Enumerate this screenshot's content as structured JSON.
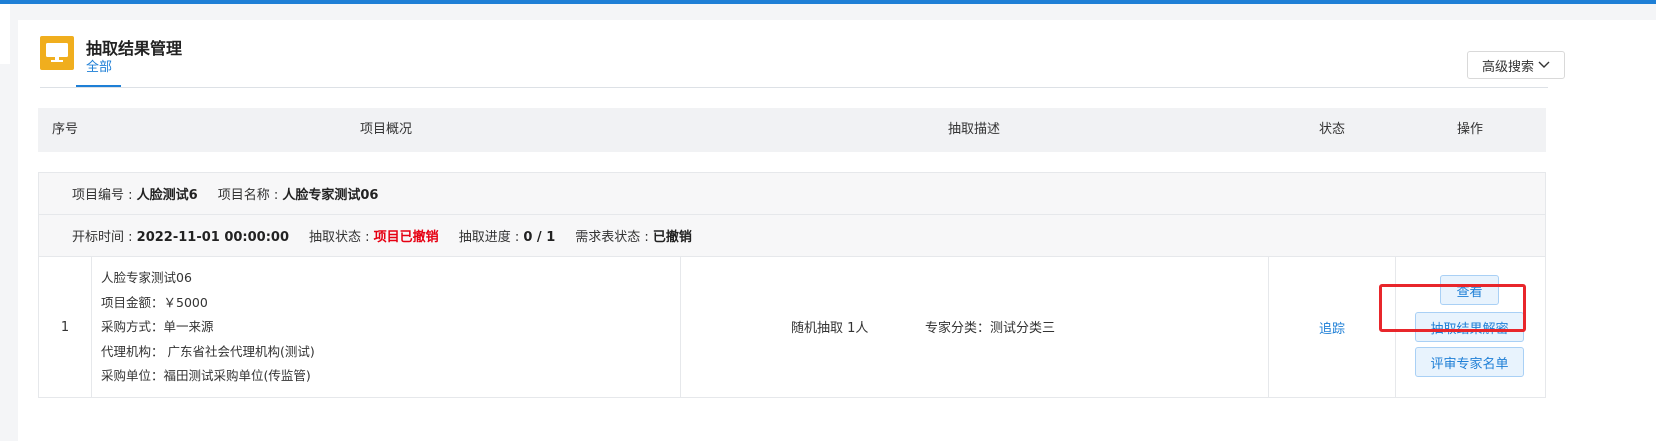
{
  "header": {
    "title": "抽取结果管理",
    "active_tab": "全部",
    "advanced_search_label": "高级搜索"
  },
  "table": {
    "columns": [
      "序号",
      "项目概况",
      "抽取描述",
      "状态",
      "操作"
    ]
  },
  "record": {
    "project_no_label": "项目编号 :",
    "project_no": "人脸测试6",
    "project_name_label": "项目名称 :",
    "project_name": "人脸专家测试06",
    "open_time_label": "开标时间 :",
    "open_time": "2022-11-01 00:00:00",
    "extract_status_label": "抽取状态 :",
    "extract_status": "项目已撤销",
    "progress_label": "抽取进度 :",
    "progress": "0 / 1",
    "requirement_status_label": "需求表状态 :",
    "requirement_status": "已撤销",
    "index": "1",
    "summary": [
      "人脸专家测试06",
      "项目金额：￥5000",
      "采购方式：单一来源",
      "代理机构： 广东省社会代理机构(测试)",
      "采购单位：福田测试采购单位(传监管)"
    ],
    "desc_method": "随机抽取 1人",
    "desc_category": "专家分类：测试分类三",
    "status_link": "追踪",
    "actions": [
      "查看",
      "抽取结果解密",
      "评审专家名单"
    ]
  },
  "colors": {
    "accent": "#1e7fd6",
    "icon_bg": "#f0ae1e",
    "highlight": "#e8262b",
    "revoked": "#e60012"
  }
}
